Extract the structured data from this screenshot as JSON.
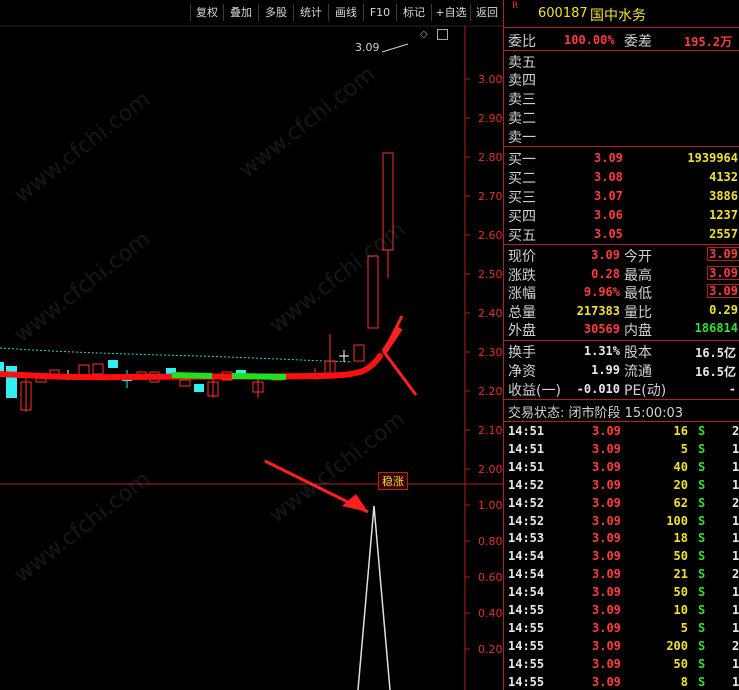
{
  "toolbar": {
    "buttons": [
      "复权",
      "叠加",
      "多股",
      "统计",
      "画线",
      "F10",
      "标记",
      "+自选",
      "返回"
    ]
  },
  "chart": {
    "price_axis": [
      "3.00",
      "2.90",
      "2.80",
      "2.70",
      "2.60",
      "2.50",
      "2.40",
      "2.30",
      "2.20",
      "2.10",
      "2.00"
    ],
    "indicator_axis": [
      "1.00",
      "0.80",
      "0.60",
      "0.40",
      "0.20"
    ],
    "high_marker": "3.09",
    "badge": "稳涨",
    "watermark": "www.cfchi.com",
    "colors": {
      "up": "#ff3030",
      "down": "#30f0f0",
      "line_red": "#ff1010",
      "line_green": "#20e020",
      "axis": "#e03030"
    }
  },
  "quote": {
    "r_mark": "R",
    "code": "600187",
    "name": "国中水务",
    "weibi_label": "委比",
    "weibi_value": "100.00%",
    "weicha_label": "委差",
    "weicha_value": "195.2万",
    "sell": [
      {
        "label": "卖五",
        "price": "",
        "vol": ""
      },
      {
        "label": "卖四",
        "price": "",
        "vol": ""
      },
      {
        "label": "卖三",
        "price": "",
        "vol": ""
      },
      {
        "label": "卖二",
        "price": "",
        "vol": ""
      },
      {
        "label": "卖一",
        "price": "",
        "vol": ""
      }
    ],
    "buy": [
      {
        "label": "买一",
        "price": "3.09",
        "vol": "1939964"
      },
      {
        "label": "买二",
        "price": "3.08",
        "vol": "4132"
      },
      {
        "label": "买三",
        "price": "3.07",
        "vol": "3886"
      },
      {
        "label": "买四",
        "price": "3.06",
        "vol": "1237"
      },
      {
        "label": "买五",
        "price": "3.05",
        "vol": "2557"
      }
    ],
    "stats": [
      {
        "l1": "现价",
        "v1": "3.09",
        "c1": "red",
        "l2": "今开",
        "v2": "3.09",
        "c2": "red"
      },
      {
        "l1": "涨跌",
        "v1": "0.28",
        "c1": "red",
        "l2": "最高",
        "v2": "3.09",
        "c2": "red"
      },
      {
        "l1": "涨幅",
        "v1": "9.96%",
        "c1": "red",
        "l2": "最低",
        "v2": "3.09",
        "c2": "red"
      },
      {
        "l1": "总量",
        "v1": "217383",
        "c1": "yel",
        "l2": "量比",
        "v2": "0.29",
        "c2": "yel"
      },
      {
        "l1": "外盘",
        "v1": "30569",
        "c1": "red",
        "l2": "内盘",
        "v2": "186814",
        "c2": "grn"
      }
    ],
    "fund": [
      {
        "l1": "换手",
        "v1": "1.31%",
        "l2": "股本",
        "v2": "16.5亿"
      },
      {
        "l1": "净资",
        "v1": "1.99",
        "l2": "流通",
        "v2": "16.5亿"
      },
      {
        "l1": "收益(一)",
        "v1": "-0.010",
        "l2": "PE(动)",
        "v2": "-"
      }
    ],
    "trade_status": "交易状态: 闭市阶段 15:00:03",
    "ticks": [
      {
        "t": "14:51",
        "p": "3.09",
        "v": "16",
        "s": "S",
        "n": "2"
      },
      {
        "t": "14:51",
        "p": "3.09",
        "v": "5",
        "s": "S",
        "n": "1"
      },
      {
        "t": "14:51",
        "p": "3.09",
        "v": "40",
        "s": "S",
        "n": "1"
      },
      {
        "t": "14:52",
        "p": "3.09",
        "v": "20",
        "s": "S",
        "n": "1"
      },
      {
        "t": "14:52",
        "p": "3.09",
        "v": "62",
        "s": "S",
        "n": "2"
      },
      {
        "t": "14:52",
        "p": "3.09",
        "v": "100",
        "s": "S",
        "n": "1"
      },
      {
        "t": "14:53",
        "p": "3.09",
        "v": "18",
        "s": "S",
        "n": "1"
      },
      {
        "t": "14:54",
        "p": "3.09",
        "v": "50",
        "s": "S",
        "n": "1"
      },
      {
        "t": "14:54",
        "p": "3.09",
        "v": "21",
        "s": "S",
        "n": "2"
      },
      {
        "t": "14:54",
        "p": "3.09",
        "v": "50",
        "s": "S",
        "n": "1"
      },
      {
        "t": "14:55",
        "p": "3.09",
        "v": "10",
        "s": "S",
        "n": "1"
      },
      {
        "t": "14:55",
        "p": "3.09",
        "v": "5",
        "s": "S",
        "n": "1"
      },
      {
        "t": "14:55",
        "p": "3.09",
        "v": "200",
        "s": "S",
        "n": "2"
      },
      {
        "t": "14:55",
        "p": "3.09",
        "v": "50",
        "s": "S",
        "n": "1"
      },
      {
        "t": "14:55",
        "p": "3.09",
        "v": "8",
        "s": "S",
        "n": "1"
      }
    ]
  }
}
